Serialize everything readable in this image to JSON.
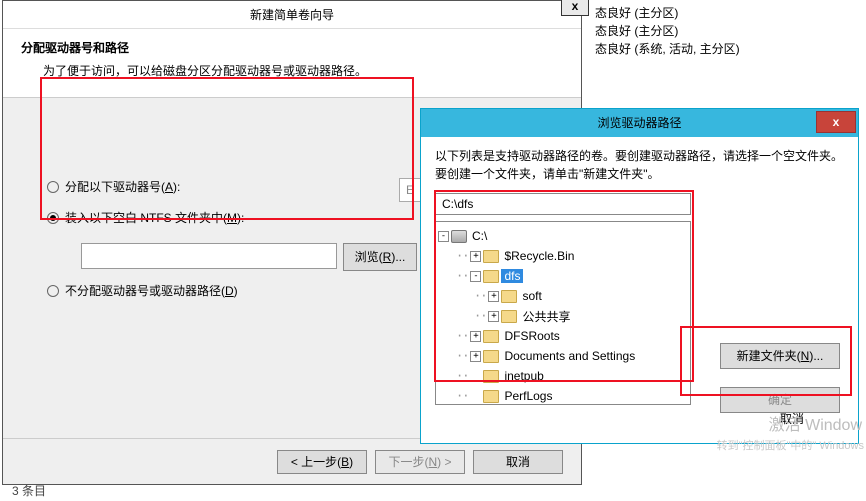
{
  "bg_parts": [
    "态良好 (主分区)",
    "态良好 (主分区)",
    "态良好 (系统, 活动, 主分区)"
  ],
  "wizard": {
    "title": "新建简单卷向导",
    "close": "x",
    "header_title": "分配驱动器号和路径",
    "header_sub": "为了便于访问，可以给磁盘分区分配驱动器号或驱动器路径。",
    "opt1_pre": "分配以下驱动器号(",
    "opt1_hot": "A",
    "opt1_post": "):",
    "opt2_pre": "装入以下空白 NTFS 文件夹中(",
    "opt2_hot": "M",
    "opt2_post": "):",
    "opt3_pre": "不分配驱动器号或驱动器路径(",
    "opt3_hot": "D",
    "opt3_post": ")",
    "browse_pre": "浏览(",
    "browse_hot": "R",
    "browse_post": ")...",
    "letter": "E",
    "back_pre": "< 上一步(",
    "back_hot": "B",
    "back_post": ")",
    "next_pre": "下一步(",
    "next_hot": "N",
    "next_post": ") >",
    "cancel": "取消"
  },
  "dlg": {
    "title": "浏览驱动器路径",
    "close": "x",
    "desc": "以下列表是支持驱动器路径的卷。要创建驱动器路径，请选择一个空文件夹。要创建一个文件夹，请单击\"新建文件夹\"。",
    "path": "C:\\dfs",
    "tree": {
      "root": "C:\\",
      "items": [
        {
          "indent": 1,
          "exp": "+",
          "label": "$Recycle.Bin"
        },
        {
          "indent": 1,
          "exp": "-",
          "label": "dfs",
          "selected": true
        },
        {
          "indent": 2,
          "exp": "+",
          "label": "soft"
        },
        {
          "indent": 2,
          "exp": "+",
          "label": "公共共享"
        },
        {
          "indent": 1,
          "exp": "+",
          "label": "DFSRoots"
        },
        {
          "indent": 1,
          "exp": "+",
          "label": "Documents and Settings"
        },
        {
          "indent": 1,
          "exp": "",
          "label": "inetpub"
        },
        {
          "indent": 1,
          "exp": "",
          "label": "PerfLogs"
        }
      ]
    },
    "new_folder_pre": "新建文件夹(",
    "new_folder_hot": "N",
    "new_folder_post": ")...",
    "ok": "确定",
    "cancel": "取消"
  },
  "watermark": "激活 Window",
  "watermark2": "转到\"控制面板\"中的\" Windows",
  "footer_count": "3 条目"
}
